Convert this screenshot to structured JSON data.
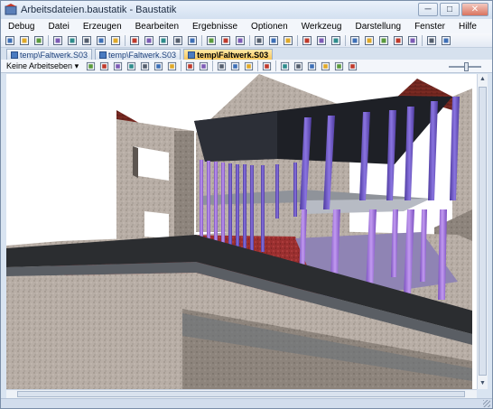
{
  "window": {
    "title": "Arbeitsdateien.baustatik - Baustatik",
    "controls": {
      "minimize": "─",
      "maximize": "□",
      "close": "✕"
    }
  },
  "menu": {
    "items": [
      "Debug",
      "Datei",
      "Erzeugen",
      "Bearbeiten",
      "Ergebnisse",
      "Optionen",
      "Werkzeug",
      "Darstellung",
      "Fenster",
      "Hilfe"
    ]
  },
  "tabs": [
    {
      "label": "temp\\Faltwerk.S03",
      "active": false
    },
    {
      "label": "temp\\Faltwerk.S03",
      "active": false
    },
    {
      "label": "temp\\Faltwerk.S03",
      "active": true
    }
  ],
  "viewbar": {
    "level_dropdown": "Keine Arbeitseben",
    "dropdown_arrow": "▾"
  },
  "scrollbar": {
    "up": "▲",
    "down": "▼"
  },
  "colors": {
    "accent_tab": "#f7c65a",
    "column_purple": "#7a5fc4",
    "floor_red": "#9a2a2a",
    "wall_gray": "#b9b0a8",
    "roof_dark": "#1e2026"
  },
  "icons": {
    "toolbar": [
      "new-file-icon",
      "open-folder-icon",
      "save-icon",
      "sep",
      "copy-icon",
      "print-preview-icon",
      "print-icon",
      "pdf-icon",
      "export-icon",
      "sep",
      "undo-icon",
      "delete-icon",
      "cut-icon",
      "paste-icon",
      "copy-format-icon",
      "sep",
      "folder-icon",
      "settings-icon",
      "window-icon",
      "sep",
      "globe-icon",
      "move-icon",
      "zoom-icon",
      "sep",
      "text-icon",
      "measure-icon",
      "property-icon",
      "sep",
      "pen-icon",
      "layers-icon",
      "table-icon",
      "grid-icon",
      "chart-icon",
      "sep",
      "calculator-icon",
      "tools-icon"
    ],
    "viewbar": [
      "select-arrow-icon",
      "select-box-icon",
      "zoom-window-icon",
      "zoom-in-icon",
      "pan-icon",
      "zoom-out-icon",
      "zoom-fit-icon",
      "sep",
      "rotate-left-icon",
      "rotate-right-icon",
      "sep",
      "wireframe-icon",
      "hidden-icon",
      "shaded-icon",
      "sep",
      "grid-toggle-icon",
      "sep",
      "view-front-icon",
      "view-side-icon",
      "view-top-icon",
      "view-iso-icon",
      "view-3d-icon",
      "view-render-icon"
    ]
  }
}
